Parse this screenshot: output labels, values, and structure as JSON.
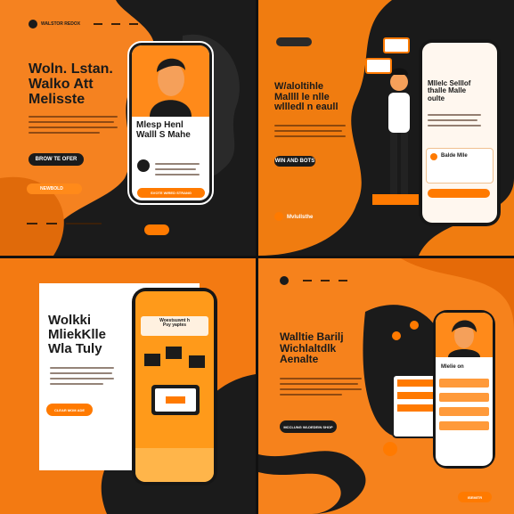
{
  "colors": {
    "orange": "#f58220",
    "dark": "#1a1a1a",
    "light": "#fff7ef"
  },
  "panel1": {
    "brand": "WALSTOR REDOX",
    "heading": "Woln. Lstan.\nWalko Att\nMelisste",
    "phone_heading": "Mlesp Henl\nWalll S Mahe",
    "cta_dark": "BROW TE OFER",
    "cta_orange": "NEWBOLD",
    "phone_cta": "SVOTE WIRED STRANG"
  },
  "panel2": {
    "heading_left": "W/aloltihle\nMallll le nlle\nwllledl n eaull",
    "heading_right": "Mllelc Selllof\nthalle Malle\noulte",
    "card_title": "Balde Mlle",
    "cta_dark": "WIN AND BOTS",
    "footer_brand": "Mvlullsthe"
  },
  "panel3": {
    "heading": "Wolkki\nMliekKlle\nWla Tuly",
    "phone_title": "Woestsuwnt h\nPsy yaptes",
    "cta": "CLEAR MOM ADE"
  },
  "panel4": {
    "heading": "Walltie Barilj\nWichlaltdlk\nAenalte",
    "card_title": "Mlelie on",
    "cta_dark": "MCCLUNG WLDEDEIN SHOP",
    "cta_orange": "ISEMITR"
  }
}
